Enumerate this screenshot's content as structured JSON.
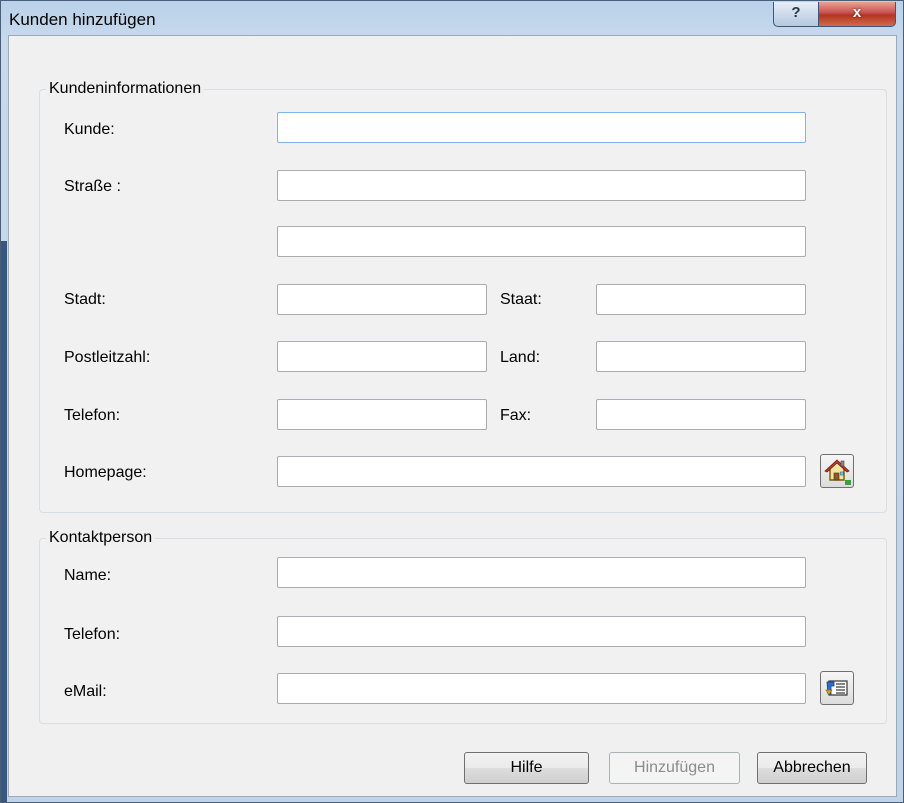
{
  "window": {
    "title": "Kunden hinzufügen",
    "help_glyph": "?",
    "close_glyph": "x"
  },
  "customer_info": {
    "group_label": "Kundeninformationen",
    "customer_label": "Kunde:",
    "street_label": "Straße :",
    "city_label": "Stadt:",
    "state_label": "Staat:",
    "zip_label": "Postleitzahl:",
    "country_label": "Land:",
    "phone_label": "Telefon:",
    "fax_label": "Fax:",
    "homepage_label": "Homepage:",
    "homepage_button_icon": "house-icon"
  },
  "contact": {
    "group_label": "Kontaktperson",
    "name_label": "Name:",
    "phone_label": "Telefon:",
    "email_label": "eMail:",
    "email_button_icon": "address-card-icon"
  },
  "buttons": {
    "help": "Hilfe",
    "add": "Hinzufügen",
    "cancel": "Abbrechen"
  }
}
